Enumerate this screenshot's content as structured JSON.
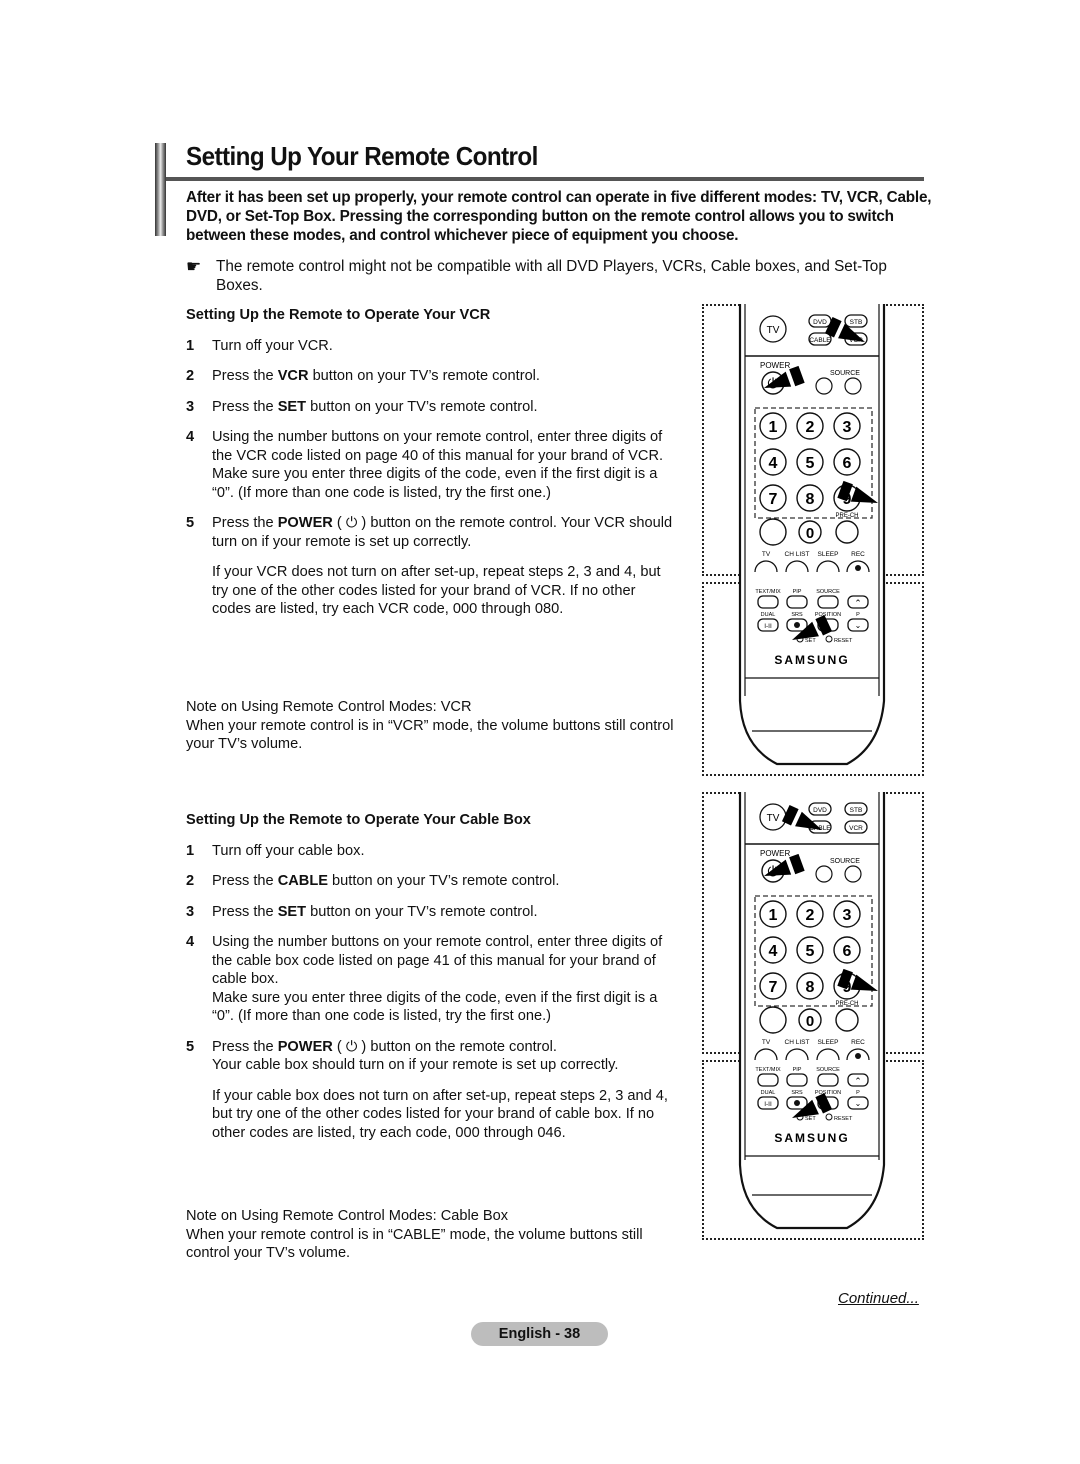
{
  "page": {
    "title": "Setting Up Your Remote Control",
    "intro": "After it has been set up properly, your remote control can operate in five different modes: TV, VCR, Cable, DVD, or Set-Top Box. Pressing the corresponding button on the remote control allows you to switch between these modes, and control whichever piece of equipment you choose.",
    "note": {
      "icon": "pointing-hand-icon",
      "glyph": "☛",
      "text": "The remote control might not be compatible with all DVD Players, VCRs, Cable boxes, and Set-Top Boxes."
    },
    "continued": "Continued...",
    "page_label": "English - 38"
  },
  "vcr": {
    "heading": "Setting Up the Remote to Operate Your VCR",
    "steps": [
      {
        "num": "1",
        "pre": "Turn off your VCR.",
        "bold": "",
        "post": ""
      },
      {
        "num": "2",
        "pre": "Press the ",
        "bold": "VCR",
        "post": " button on your TV’s remote control."
      },
      {
        "num": "3",
        "pre": "Press the ",
        "bold": "SET",
        "post": " button on your TV’s remote control."
      },
      {
        "num": "4",
        "pre": "Using the number buttons on your remote control, enter three digits of the VCR code listed on page 40 of this manual for your brand of VCR. Make sure you enter three digits of the code, even if the first digit is a “0”. (If more than one code is listed, try the first one.)",
        "bold": "",
        "post": ""
      },
      {
        "num": "5",
        "pre": "Press the ",
        "bold": "POWER",
        "post": " ( ⏻ ) button on the remote control. Your VCR should turn on if your remote is set up correctly.",
        "sub": "If your VCR does not turn on after set-up, repeat steps 2, 3 and 4, but try one of the other codes listed for your brand of VCR. If no other codes are listed, try each VCR code, 000 through 080."
      }
    ],
    "note_title": "Note on Using Remote Control Modes: VCR",
    "note_text": "When your remote control is in “VCR” mode, the volume buttons still control your TV’s volume."
  },
  "cable": {
    "heading": "Setting Up the Remote to Operate Your Cable Box",
    "steps": [
      {
        "num": "1",
        "pre": "Turn off your cable box.",
        "bold": "",
        "post": ""
      },
      {
        "num": "2",
        "pre": "Press the ",
        "bold": "CABLE",
        "post": " button on your TV’s remote control."
      },
      {
        "num": "3",
        "pre": "Press the ",
        "bold": "SET",
        "post": " button on your TV’s remote control."
      },
      {
        "num": "4",
        "pre": "Using the number buttons on your remote control, enter three digits of the cable box code listed on page 41 of this manual for your brand of cable box.",
        "pre2": "Make sure you enter three digits of the code, even if the first digit is a “0”. (If more than one code is listed, try the first one.)",
        "bold": "",
        "post": ""
      },
      {
        "num": "5",
        "pre": "Press the ",
        "bold": "POWER",
        "post": " ( ⏻ ) button on the remote control.",
        "post2": "Your cable box should turn on if your remote is set up correctly.",
        "sub": "If your cable box does not turn on after set-up, repeat steps 2, 3 and 4, but try one of the other codes listed for your brand of cable box. If no other codes are listed, try each code, 000 through 046."
      }
    ],
    "note_title": "Note on Using Remote Control Modes: Cable Box",
    "note_text": "When your remote control is in “CABLE” mode, the volume buttons still control your TV’s volume."
  },
  "remote": {
    "mode_buttons": [
      "TV",
      "DVD",
      "STB",
      "CABLE",
      "VCR"
    ],
    "power_label": "POWER",
    "source_label": "SOURCE",
    "number_buttons": [
      "1",
      "2",
      "3",
      "4",
      "5",
      "6",
      "7",
      "8",
      "9",
      "0"
    ],
    "pre_ch_label": "PRE-CH",
    "row_labels": [
      "TV",
      "CH LIST",
      "SLEEP",
      "REC"
    ],
    "func_labels_top": [
      "TEXT/MIX",
      "PIP",
      "SOURCE"
    ],
    "func_labels_bottom": [
      "DUAL",
      "SRS",
      "POSITION",
      "P"
    ],
    "dual_glyph": "I-II",
    "set_label": "SET",
    "reset_label": "RESET",
    "brand": "SAMSUNG"
  }
}
